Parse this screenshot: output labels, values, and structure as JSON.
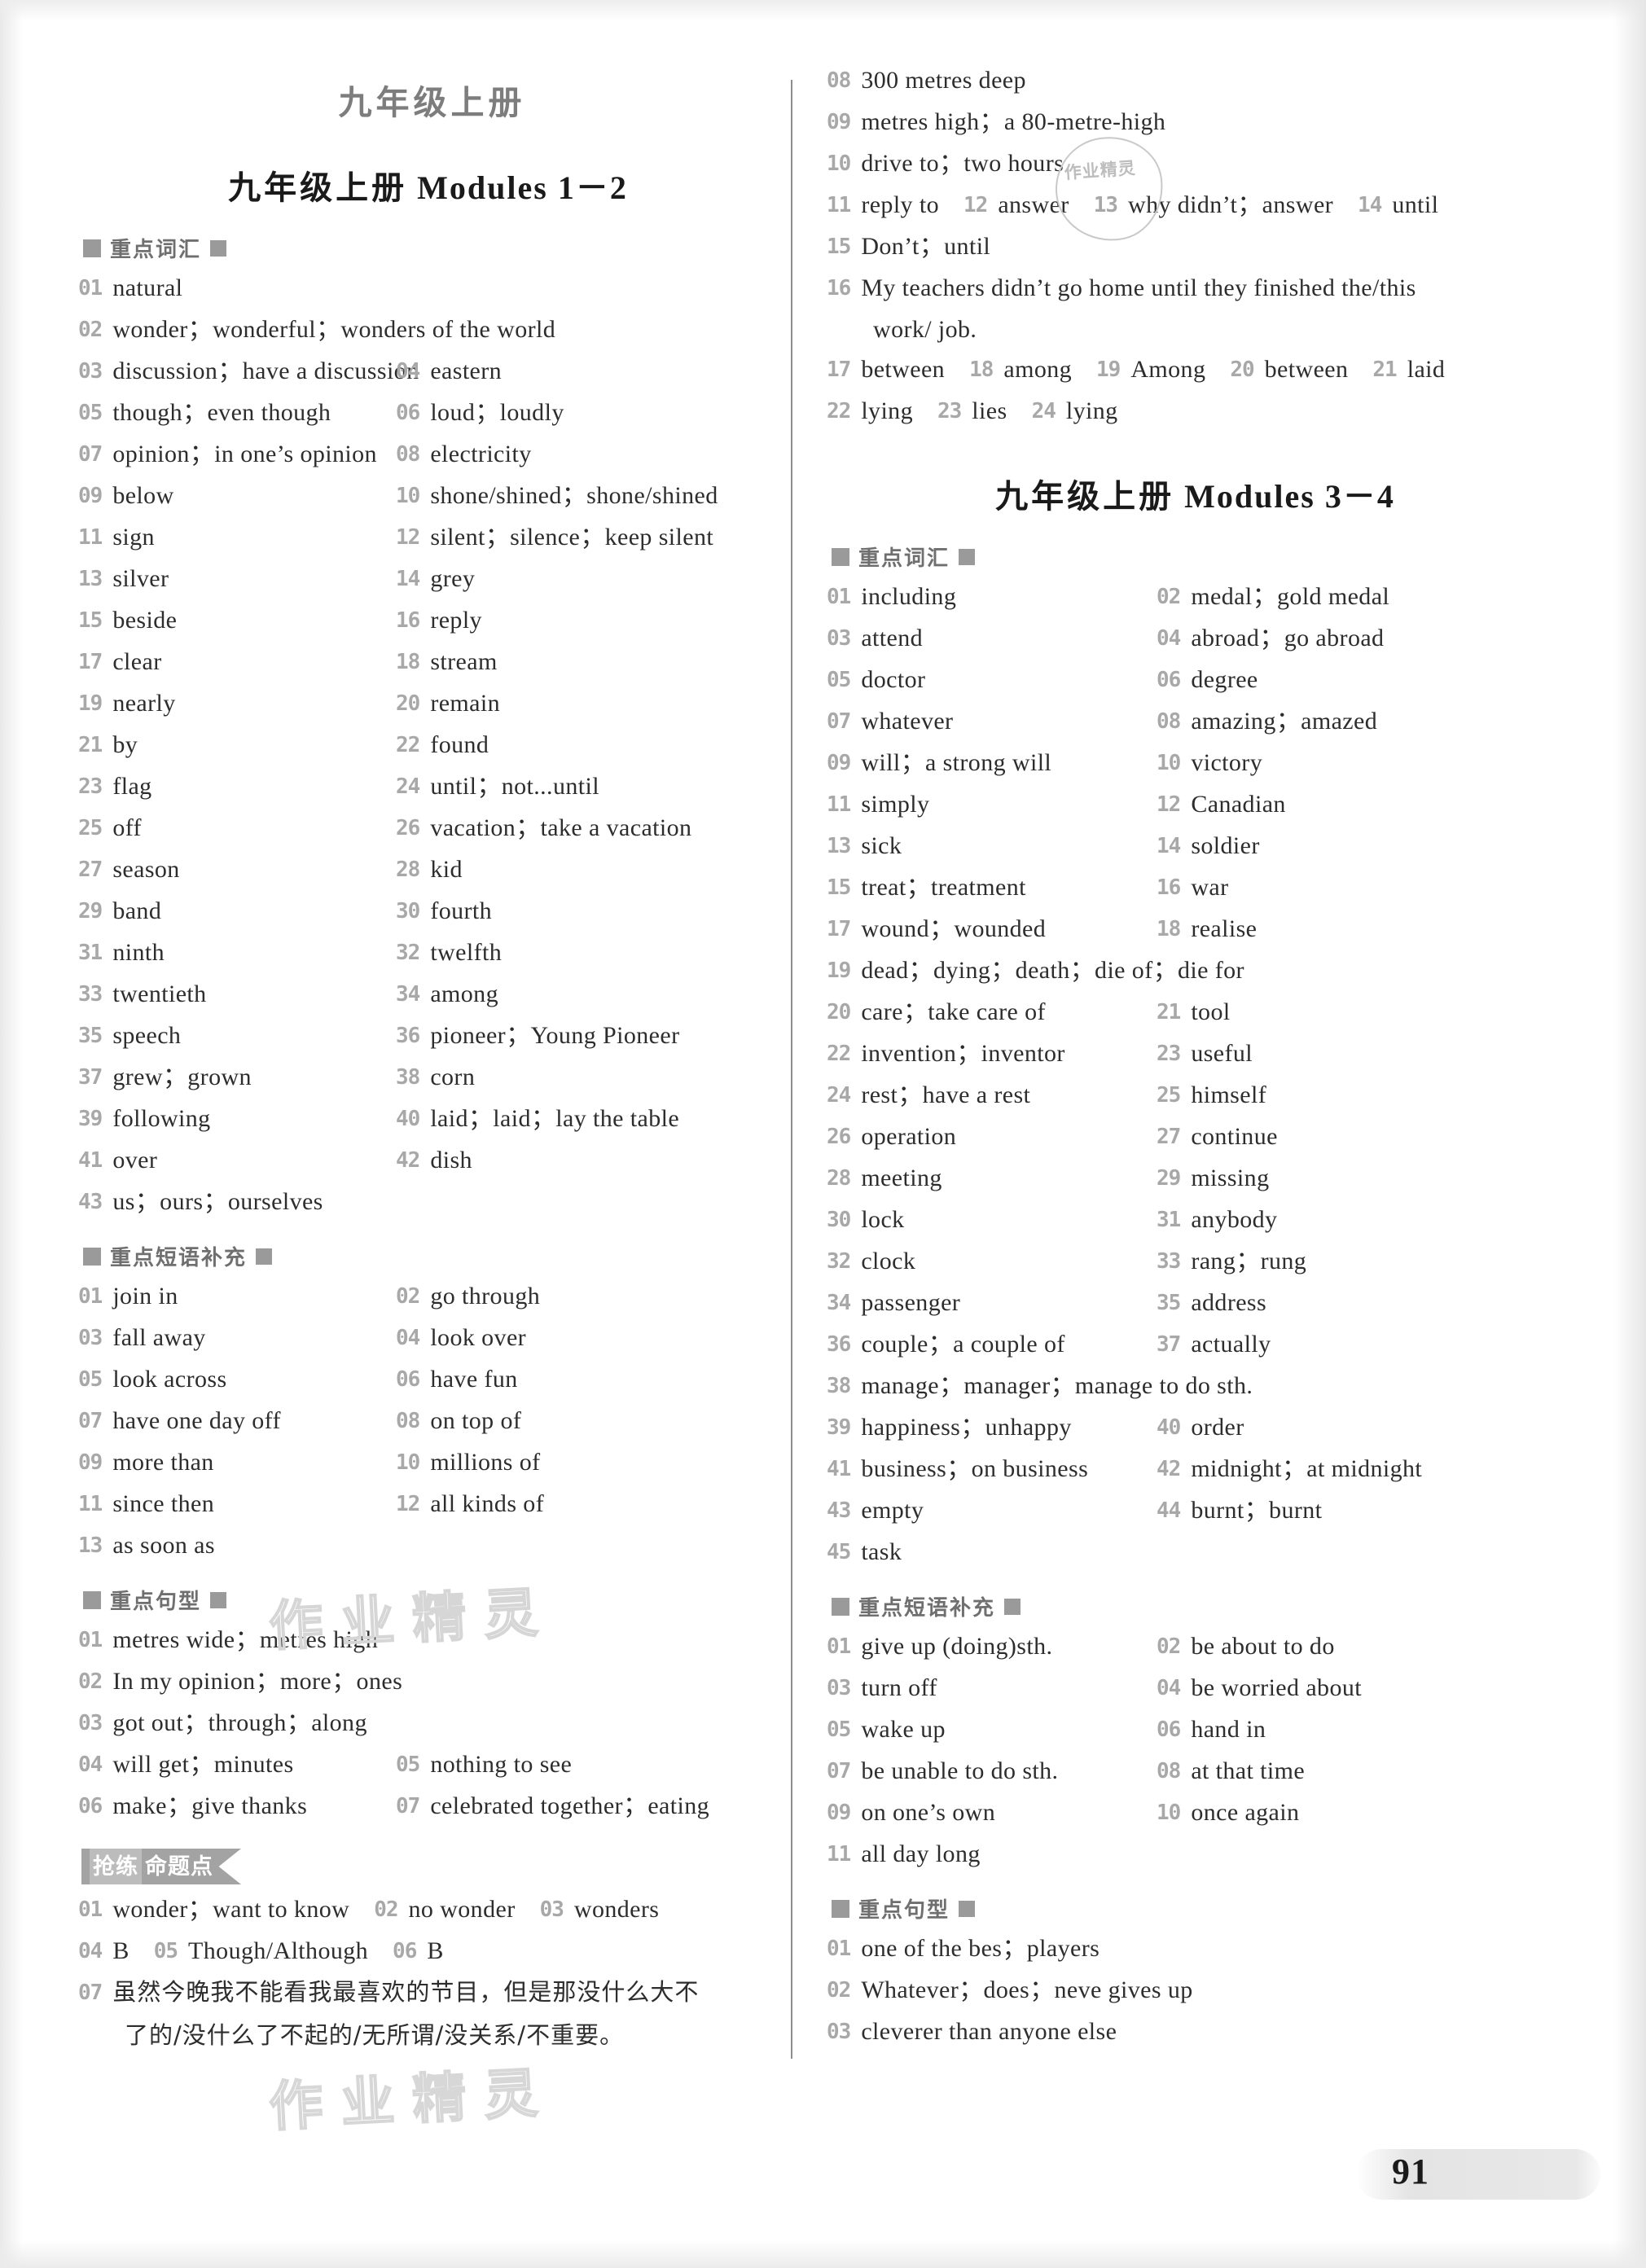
{
  "page": {
    "book_title": "九年级上册",
    "page_number": "91",
    "watermark_text": "作业精灵",
    "stamp_text": "作业精灵"
  },
  "sections": {
    "vocab": "重点词汇",
    "phrases": "重点短语补充",
    "sentences": "重点句型"
  },
  "badge": {
    "part1": "抢练",
    "part2": "命题点"
  },
  "left": {
    "module_title_cn": "九年级上册",
    "module_title_en": "Modules 1－2",
    "vocab": [
      {
        "n": "01",
        "t": "natural"
      },
      {
        "n": "02",
        "t": "wonder；wonderful；wonders of the world",
        "full": true
      },
      {
        "n": "03",
        "t": "discussion；have a discussion",
        "n2": "04",
        "t2": "eastern"
      },
      {
        "n": "05",
        "t": "though；even though",
        "n2": "06",
        "t2": "loud；loudly"
      },
      {
        "n": "07",
        "t": "opinion；in one’s opinion",
        "n2": "08",
        "t2": "electricity"
      },
      {
        "n": "09",
        "t": "below",
        "n2": "10",
        "t2": "shone/shined；shone/shined"
      },
      {
        "n": "11",
        "t": "sign",
        "n2": "12",
        "t2": "silent；silence；keep silent"
      },
      {
        "n": "13",
        "t": "silver",
        "n2": "14",
        "t2": "grey"
      },
      {
        "n": "15",
        "t": "beside",
        "n2": "16",
        "t2": "reply"
      },
      {
        "n": "17",
        "t": "clear",
        "n2": "18",
        "t2": "stream"
      },
      {
        "n": "19",
        "t": "nearly",
        "n2": "20",
        "t2": "remain"
      },
      {
        "n": "21",
        "t": "by",
        "n2": "22",
        "t2": "found"
      },
      {
        "n": "23",
        "t": "flag",
        "n2": "24",
        "t2": "until；not...until"
      },
      {
        "n": "25",
        "t": "off",
        "n2": "26",
        "t2": "vacation；take a vacation"
      },
      {
        "n": "27",
        "t": "season",
        "n2": "28",
        "t2": "kid"
      },
      {
        "n": "29",
        "t": "band",
        "n2": "30",
        "t2": "fourth"
      },
      {
        "n": "31",
        "t": "ninth",
        "n2": "32",
        "t2": "twelfth"
      },
      {
        "n": "33",
        "t": "twentieth",
        "n2": "34",
        "t2": "among"
      },
      {
        "n": "35",
        "t": "speech",
        "n2": "36",
        "t2": "pioneer；Young Pioneer"
      },
      {
        "n": "37",
        "t": "grew；grown",
        "n2": "38",
        "t2": "corn"
      },
      {
        "n": "39",
        "t": "following",
        "n2": "40",
        "t2": "laid；laid；lay the table"
      },
      {
        "n": "41",
        "t": "over",
        "n2": "42",
        "t2": "dish"
      },
      {
        "n": "43",
        "t": "us；ours；ourselves",
        "full": true
      }
    ],
    "phrases": [
      {
        "n": "01",
        "t": "join in",
        "n2": "02",
        "t2": "go through"
      },
      {
        "n": "03",
        "t": "fall away",
        "n2": "04",
        "t2": "look over"
      },
      {
        "n": "05",
        "t": "look across",
        "n2": "06",
        "t2": "have fun"
      },
      {
        "n": "07",
        "t": "have one day off",
        "n2": "08",
        "t2": "on top of"
      },
      {
        "n": "09",
        "t": "more than",
        "n2": "10",
        "t2": "millions of"
      },
      {
        "n": "11",
        "t": "since then",
        "n2": "12",
        "t2": "all kinds of"
      },
      {
        "n": "13",
        "t": "as soon as",
        "full": true
      }
    ],
    "sentences": [
      {
        "n": "01",
        "t": "metres wide；metres high",
        "full": true
      },
      {
        "n": "02",
        "t": "In my opinion；more；ones",
        "full": true
      },
      {
        "n": "03",
        "t": "got out；through；along",
        "full": true
      },
      {
        "n": "04",
        "t": "will get；minutes",
        "n2": "05",
        "t2": "nothing to see"
      },
      {
        "n": "06",
        "t": "make；give thanks",
        "n2": "07",
        "t2": "celebrated together；eating"
      }
    ],
    "answers_inline": [
      [
        {
          "n": "01",
          "t": "wonder；want to know"
        },
        {
          "n": "02",
          "t": "no wonder"
        },
        {
          "n": "03",
          "t": "wonders"
        }
      ],
      [
        {
          "n": "04",
          "t": "B"
        },
        {
          "n": "05",
          "t": "Though/Although"
        },
        {
          "n": "06",
          "t": "B"
        }
      ]
    ],
    "answer_cn": {
      "n": "07",
      "line1": "虽然今晚我不能看我最喜欢的节目，但是那没什么大不",
      "line2": "了的/没什么了不起的/无所谓/没关系/不重要。"
    }
  },
  "right": {
    "top_continued": [
      {
        "n": "08",
        "t": "300 metres deep",
        "full": true
      },
      {
        "n": "09",
        "t": "metres high；a 80-metre-high",
        "full": true
      },
      {
        "n": "10",
        "t": "drive to；two hours",
        "full": true
      }
    ],
    "inline_rows": [
      [
        {
          "n": "11",
          "t": "reply to"
        },
        {
          "n": "12",
          "t": "answer"
        },
        {
          "n": "13",
          "t": "why didn’t；answer"
        },
        {
          "n": "14",
          "t": "until"
        }
      ],
      [
        {
          "n": "15",
          "t": "Don’t；until"
        }
      ]
    ],
    "long_sentence": {
      "n": "16",
      "line1": "My teachers didn’t go home until they finished the/this",
      "line2": "work/ job."
    },
    "inline_rows2": [
      [
        {
          "n": "17",
          "t": "between"
        },
        {
          "n": "18",
          "t": "among"
        },
        {
          "n": "19",
          "t": "Among"
        },
        {
          "n": "20",
          "t": "between"
        },
        {
          "n": "21",
          "t": "laid"
        }
      ],
      [
        {
          "n": "22",
          "t": "lying"
        },
        {
          "n": "23",
          "t": "lies"
        },
        {
          "n": "24",
          "t": "lying"
        }
      ]
    ],
    "module_title_cn": "九年级上册",
    "module_title_en": "Modules 3－4",
    "vocab": [
      {
        "n": "01",
        "t": "including",
        "n2": "02",
        "t2": "medal；gold medal"
      },
      {
        "n": "03",
        "t": "attend",
        "n2": "04",
        "t2": "abroad；go abroad"
      },
      {
        "n": "05",
        "t": "doctor",
        "n2": "06",
        "t2": "degree"
      },
      {
        "n": "07",
        "t": "whatever",
        "n2": "08",
        "t2": "amazing；amazed"
      },
      {
        "n": "09",
        "t": "will；a strong will",
        "n2": "10",
        "t2": "victory"
      },
      {
        "n": "11",
        "t": "simply",
        "n2": "12",
        "t2": "Canadian"
      },
      {
        "n": "13",
        "t": "sick",
        "n2": "14",
        "t2": "soldier"
      },
      {
        "n": "15",
        "t": "treat；treatment",
        "n2": "16",
        "t2": "war"
      },
      {
        "n": "17",
        "t": "wound；wounded",
        "n2": "18",
        "t2": "realise"
      },
      {
        "n": "19",
        "t": "dead；dying；death；die of；die for",
        "full": true
      },
      {
        "n": "20",
        "t": "care；take care of",
        "n2": "21",
        "t2": "tool"
      },
      {
        "n": "22",
        "t": "invention；inventor",
        "n2": "23",
        "t2": "useful"
      },
      {
        "n": "24",
        "t": "rest；have a rest",
        "n2": "25",
        "t2": "himself"
      },
      {
        "n": "26",
        "t": "operation",
        "n2": "27",
        "t2": "continue"
      },
      {
        "n": "28",
        "t": "meeting",
        "n2": "29",
        "t2": "missing"
      },
      {
        "n": "30",
        "t": "lock",
        "n2": "31",
        "t2": "anybody"
      },
      {
        "n": "32",
        "t": "clock",
        "n2": "33",
        "t2": "rang；rung"
      },
      {
        "n": "34",
        "t": "passenger",
        "n2": "35",
        "t2": "address"
      },
      {
        "n": "36",
        "t": "couple；a couple of",
        "n2": "37",
        "t2": "actually"
      },
      {
        "n": "38",
        "t": "manage；manager；manage to do sth.",
        "full": true
      },
      {
        "n": "39",
        "t": "happiness；unhappy",
        "n2": "40",
        "t2": "order"
      },
      {
        "n": "41",
        "t": "business；on business",
        "n2": "42",
        "t2": "midnight；at midnight"
      },
      {
        "n": "43",
        "t": "empty",
        "n2": "44",
        "t2": "burnt；burnt"
      },
      {
        "n": "45",
        "t": "task",
        "full": true
      }
    ],
    "phrases": [
      {
        "n": "01",
        "t": "give up (doing)sth.",
        "n2": "02",
        "t2": "be about to do"
      },
      {
        "n": "03",
        "t": "turn off",
        "n2": "04",
        "t2": "be worried about"
      },
      {
        "n": "05",
        "t": "wake up",
        "n2": "06",
        "t2": "hand in"
      },
      {
        "n": "07",
        "t": "be unable to do sth.",
        "n2": "08",
        "t2": "at that time"
      },
      {
        "n": "09",
        "t": "on one’s own",
        "n2": "10",
        "t2": "once again"
      },
      {
        "n": "11",
        "t": "all day long",
        "full": true
      }
    ],
    "sentences": [
      {
        "n": "01",
        "t": "one of the bes；players",
        "full": true
      },
      {
        "n": "02",
        "t": "Whatever；does；neve gives up",
        "full": true
      },
      {
        "n": "03",
        "t": "cleverer than anyone else",
        "full": true
      }
    ]
  }
}
